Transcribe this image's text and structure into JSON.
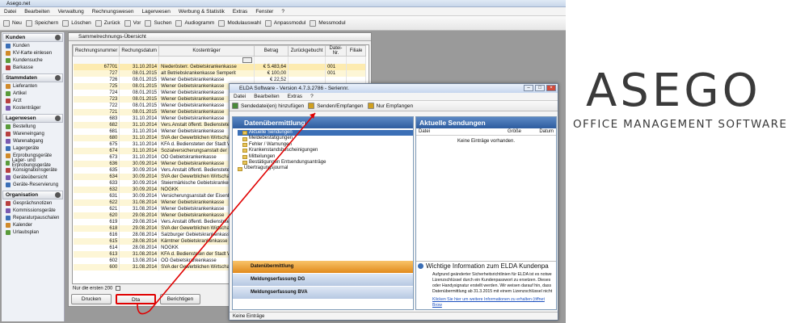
{
  "app": {
    "title": "Asego.net"
  },
  "menu": [
    "Datei",
    "Bearbeiten",
    "Verwaltung",
    "Rechnungswesen",
    "Lagerwesen",
    "Werbung & Statistik",
    "Extras",
    "Fenster",
    "?"
  ],
  "toolbar": [
    "Neu",
    "Speichern",
    "Löschen",
    "Zurück",
    "Vor",
    "Suchen",
    "Audiogramm",
    "Modulauswahl",
    "Anpassmodul",
    "Messmodul"
  ],
  "sidebar": [
    {
      "title": "Kunden",
      "items": [
        "Kunden",
        "KV-Karte einlesen",
        "Kundensuche",
        "Barkasse"
      ]
    },
    {
      "title": "Stammdaten",
      "items": [
        "Lieferanten",
        "Artikel",
        "Arzt",
        "Kostenträger"
      ]
    },
    {
      "title": "Lagerwesen",
      "items": [
        "Bestellung",
        "Wareneingang",
        "Warenabgang",
        "Lagergeräte",
        "Erprobungsgeräte",
        "Lager- und Erprobungsgeräte",
        "Konsignationsgeräte",
        "Geräteübersicht",
        "Geräte-Reservierung"
      ]
    },
    {
      "title": "Organisation",
      "items": [
        "Gesprächsnotizen",
        "Kommissionsgeräte",
        "Reparaturpauschalen",
        "Kalender",
        "Urlaubsplan"
      ]
    }
  ],
  "mainwindow": {
    "title": "Sammelrechnungs-Übersicht",
    "columns": [
      "Rechnungsnummer",
      "Rechungsdatum",
      "Kostenträger",
      "Betrag",
      "Zurückgebucht",
      "Datei-Nr.",
      "Filiale"
    ],
    "rows": [
      [
        "67701",
        "31.10.2014",
        "Niederösterr. Gebietskrankenkasse",
        "€ 5.483,64",
        "",
        "001"
      ],
      [
        "727",
        "08.01.2015",
        "alt Betriebskrankenkasse Semperit",
        "€ 100,00",
        "",
        "001"
      ],
      [
        "726",
        "08.01.2015",
        "Wiener Gebietskrankenkasse",
        "€ 22,52",
        "",
        ""
      ],
      [
        "725",
        "08.01.2015",
        "Wiener Gebietskrankenkasse",
        "",
        "",
        ""
      ],
      [
        "724",
        "08.01.2015",
        "Wiener Gebietskrankenkasse",
        "",
        "",
        ""
      ],
      [
        "723",
        "08.01.2015",
        "Wiener Gebietskrankenkasse",
        "",
        "",
        ""
      ],
      [
        "722",
        "08.01.2015",
        "Wiener Gebietskrankenkasse",
        "",
        "",
        ""
      ],
      [
        "721",
        "08.01.2015",
        "Wiener Gebietskrankenkasse",
        "",
        "",
        ""
      ],
      [
        "683",
        "31.10.2014",
        "Wiener Gebietskrankenkasse",
        "",
        "",
        ""
      ],
      [
        "682",
        "31.10.2014",
        "Vers.Anstalt öffentl. Bedienstete",
        "",
        "",
        ""
      ],
      [
        "681",
        "31.10.2014",
        "Wiener Gebietskrankenkasse",
        "",
        "",
        ""
      ],
      [
        "680",
        "31.10.2014",
        "SVA der Gewerblichen Wirtschaft",
        "",
        "",
        ""
      ],
      [
        "675",
        "31.10.2014",
        "KFA d. Bediensteten der Stadt Wien",
        "",
        "",
        ""
      ],
      [
        "674",
        "31.10.2014",
        "Sozialversicherungsanstalt der Ba",
        "",
        "",
        ""
      ],
      [
        "673",
        "31.10.2014",
        "OÖ Gebietskrankenkasse",
        "",
        "",
        ""
      ],
      [
        "636",
        "30.09.2014",
        "Wiener Gebietskrankenkasse",
        "",
        "",
        ""
      ],
      [
        "635",
        "30.09.2014",
        "Vers.Anstalt öffentl. Bedienstete",
        "",
        "",
        ""
      ],
      [
        "634",
        "30.09.2014",
        "SVA der Gewerblichen Wirtschaft",
        "",
        "",
        ""
      ],
      [
        "633",
        "30.09.2014",
        "Steiermärkische Gebietskrankenkasse",
        "",
        "",
        ""
      ],
      [
        "632",
        "30.09.2014",
        "NÖGKK",
        "",
        "",
        ""
      ],
      [
        "631",
        "30.09.2014",
        "Versicherungsanstalt der Eisenbah",
        "",
        "",
        ""
      ],
      [
        "622",
        "31.08.2014",
        "Wiener Gebietskrankenkasse",
        "",
        "",
        ""
      ],
      [
        "621",
        "31.08.2014",
        "Wiener Gebietskrankenkasse",
        "",
        "",
        ""
      ],
      [
        "620",
        "29.08.2014",
        "Wiener Gebietskrankenkasse",
        "",
        "",
        ""
      ],
      [
        "619",
        "29.08.2014",
        "Vers.Anstalt öffentl. Bedienstete",
        "",
        "",
        ""
      ],
      [
        "618",
        "29.08.2014",
        "SVA der Gewerblichen Wirtschaft",
        "",
        "",
        ""
      ],
      [
        "616",
        "28.08.2014",
        "Salzburger Gebietskrankenkasse",
        "",
        "",
        ""
      ],
      [
        "615",
        "28.08.2014",
        "Kärntner Gebietskrankenkasse",
        "",
        "",
        ""
      ],
      [
        "614",
        "28.08.2014",
        "NÖGKK",
        "",
        "",
        ""
      ],
      [
        "613",
        "31.08.2014",
        "KFA d. Bediensteten der Stadt Wien",
        "",
        "",
        ""
      ],
      [
        "602",
        "13.08.2014",
        "OÖ Gebietskrankenkasse",
        "",
        "",
        ""
      ],
      [
        "600",
        "31.08.2014",
        "SVA der Gewerblichen Wirtschaft",
        "",
        "",
        ""
      ]
    ],
    "footer_label": "Nur die ersten 200",
    "buttons": [
      "Drucken",
      "Dta",
      "Berichtigen"
    ]
  },
  "elda": {
    "title": "ELDA Software - Version 4.7.3.2786 - Seriennr.",
    "menu": [
      "Datei",
      "Bearbeiten",
      "Extras",
      "?"
    ],
    "toolbar": [
      "Sendedatei(en) hinzufügen",
      "Senden/Empfangen",
      "Nur Empfangen"
    ],
    "left_header": "Datenübermittlung",
    "tree": [
      "Aktuelle Sendungen",
      "Meldebestätigungen",
      "Fehler / Warnungen",
      "Krankenstandsbescheinigungen",
      "Mitteilungen",
      "Bestätigungen Entsendungsanträge",
      "Übertragungsjournal"
    ],
    "nav": [
      "Datenübermittlung",
      "Meldungserfassung DG",
      "Meldungserfassung BVA"
    ],
    "right_header": "Aktuelle Sendungen",
    "right_columns": [
      "Datei",
      "Größe",
      "Datum"
    ],
    "empty_text": "Keine Einträge vorhanden.",
    "info_title": "Wichtige Information zum ELDA Kundenpa",
    "info_text": "Aufgrund geänderter Sicherheitsrichtlinien für ELDA ist es notwe Lizenzschlüssel durch ein Kundenpasswort zu ersetzen. Dieses oder Handysignatur erstellt werden. Wir weisen darauf hin, dass Datenübermittlung ab 31.3.2015 mit einem Lizenzschlüssel nicht",
    "info_link": "Klicken Sie hier um weitere Informationen zu erhalten (öffnet Brow",
    "status": "Keine Einträge"
  },
  "logo": {
    "word": "ASEGO",
    "tagline": "OFFICE MANAGEMENT SOFTWARE"
  },
  "colors": {
    "accent_blue": "#2d5c9f",
    "nav_orange": "#e18a1c",
    "arrow_red": "#e00000",
    "row_yellow": "#fdf6d6"
  }
}
